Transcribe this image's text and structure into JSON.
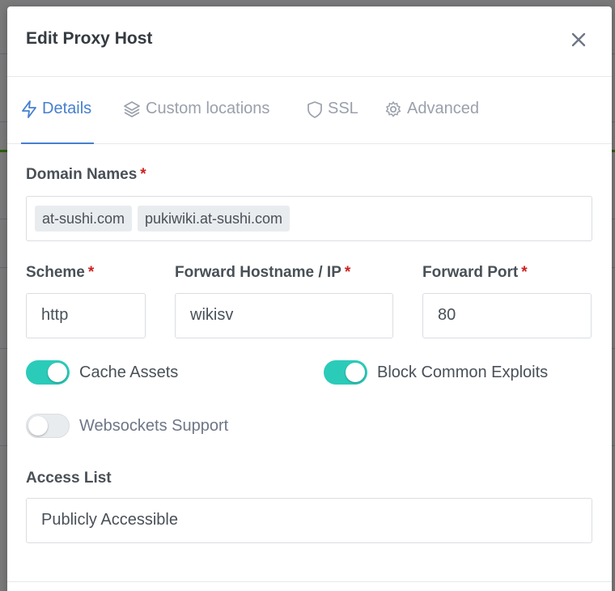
{
  "modal": {
    "title": "Edit Proxy Host"
  },
  "tabs": [
    {
      "label": "Details",
      "icon": "lightning-icon",
      "active": true
    },
    {
      "label": "Custom locations",
      "icon": "layers-icon",
      "active": false
    },
    {
      "label": "SSL",
      "icon": "shield-icon",
      "active": false
    },
    {
      "label": "Advanced",
      "icon": "gear-icon",
      "active": false
    }
  ],
  "domain_names": {
    "label": "Domain Names",
    "required_mark": "*",
    "chips": [
      "at-sushi.com",
      "pukiwiki.at-sushi.com"
    ]
  },
  "scheme": {
    "label": "Scheme",
    "required_mark": "*",
    "value": "http"
  },
  "forward_host": {
    "label": "Forward Hostname / IP",
    "required_mark": "*",
    "value": "wikisv"
  },
  "forward_port": {
    "label": "Forward Port",
    "required_mark": "*",
    "value": "80"
  },
  "toggles": {
    "cache_assets": {
      "label": "Cache Assets",
      "on": true
    },
    "block_exploits": {
      "label": "Block Common Exploits",
      "on": true
    },
    "websockets": {
      "label": "Websockets Support",
      "on": false
    }
  },
  "access_list": {
    "label": "Access List",
    "value": "Publicly Accessible"
  },
  "colors": {
    "accent": "#467fcf",
    "toggle_on": "#2bcbba",
    "required": "#cd201f"
  }
}
